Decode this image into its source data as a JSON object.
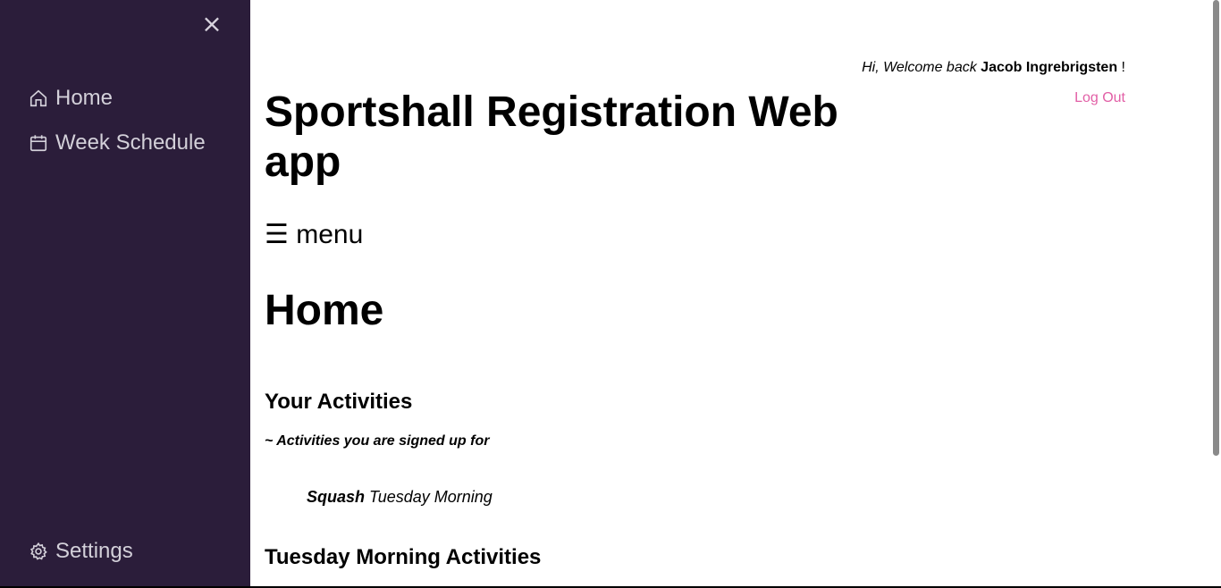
{
  "sidebar": {
    "close_glyph": "×",
    "items": [
      {
        "label": "Home",
        "icon": "home-icon"
      },
      {
        "label": "Week Schedule",
        "icon": "calendar-icon"
      }
    ],
    "settings": {
      "label": "Settings",
      "icon": "gear-icon"
    },
    "background": "#2b1d3a"
  },
  "header": {
    "greeting": "Hi, Welcome back",
    "username": "Jacob Ingrebrigsten",
    "exclaim": "!",
    "logout_label": "Log Out",
    "logout_color": "#e25fa6"
  },
  "main": {
    "app_title": "Sportshall Registration Web app",
    "menu_glyph": "☰",
    "menu_label": "menu",
    "page_heading": "Home",
    "activities_heading": "Your Activities",
    "activities_subtitle": "~ Activities you are signed up for",
    "activities": [
      {
        "name": "Squash",
        "time": "Tuesday Morning"
      }
    ],
    "tuesday_heading": "Tuesday Morning Activities"
  }
}
